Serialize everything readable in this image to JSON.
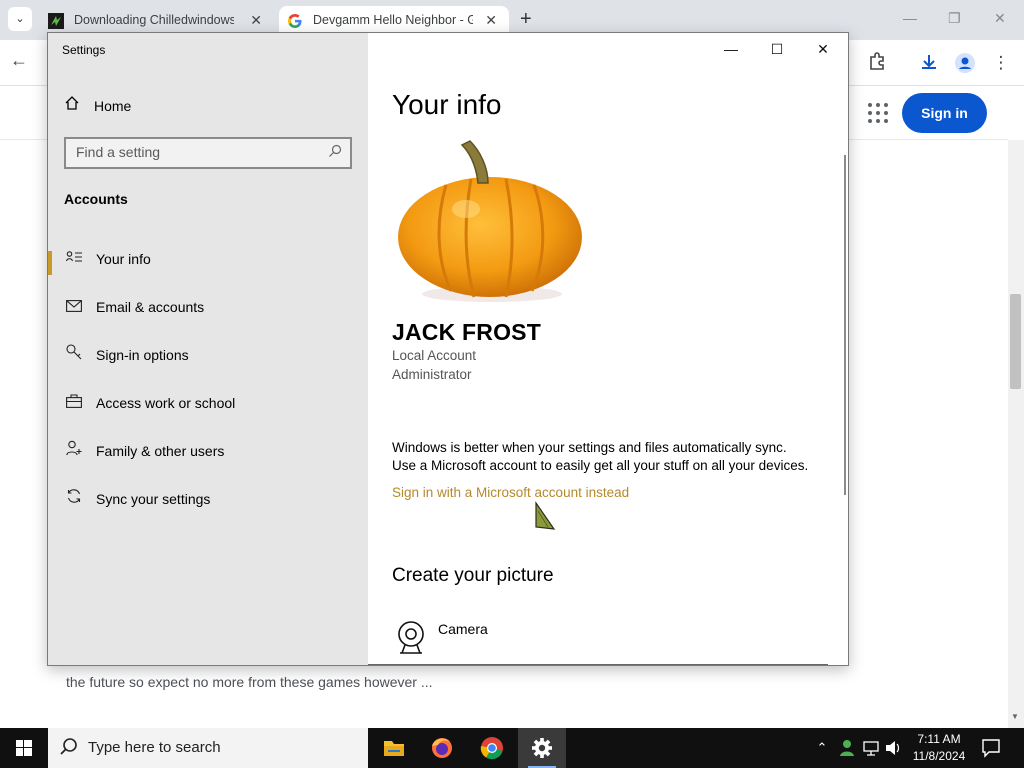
{
  "browser": {
    "tabs": [
      {
        "title": "Downloading Chilledwindows.e",
        "favicon": "download-icon"
      },
      {
        "title": "Devgamm Hello Neighbor - Go",
        "favicon": "google-icon",
        "active": true
      }
    ],
    "signin_label": "Sign in",
    "page_snippet": "the future so expect no more from these games however ..."
  },
  "settings": {
    "window_title": "Settings",
    "home_label": "Home",
    "search_placeholder": "Find a setting",
    "section_title": "Accounts",
    "nav": [
      {
        "label": "Your info",
        "icon": "your-info-icon",
        "active": true
      },
      {
        "label": "Email & accounts",
        "icon": "mail-icon"
      },
      {
        "label": "Sign-in options",
        "icon": "key-icon"
      },
      {
        "label": "Access work or school",
        "icon": "briefcase-icon"
      },
      {
        "label": "Family & other users",
        "icon": "person-add-icon"
      },
      {
        "label": "Sync your settings",
        "icon": "sync-icon"
      }
    ],
    "main": {
      "heading": "Your info",
      "user_name": "JACK FROST",
      "account_type": "Local Account",
      "account_role": "Administrator",
      "sync_text_1": "Windows is better when your settings and files automatically sync.",
      "sync_text_2": "Use a Microsoft account to easily get all your stuff on all your devices.",
      "ms_link": "Sign in with a Microsoft account instead",
      "create_picture": "Create your picture",
      "camera_label": "Camera"
    }
  },
  "taskbar": {
    "search_placeholder": "Type here to search",
    "time": "7:11 AM",
    "date": "11/8/2024",
    "apps": [
      "file-explorer",
      "firefox",
      "chrome",
      "settings"
    ]
  },
  "colors": {
    "accent_link": "#b38a2c",
    "signin_button": "#0b57d0",
    "nav_indicator": "#c89a2a"
  }
}
